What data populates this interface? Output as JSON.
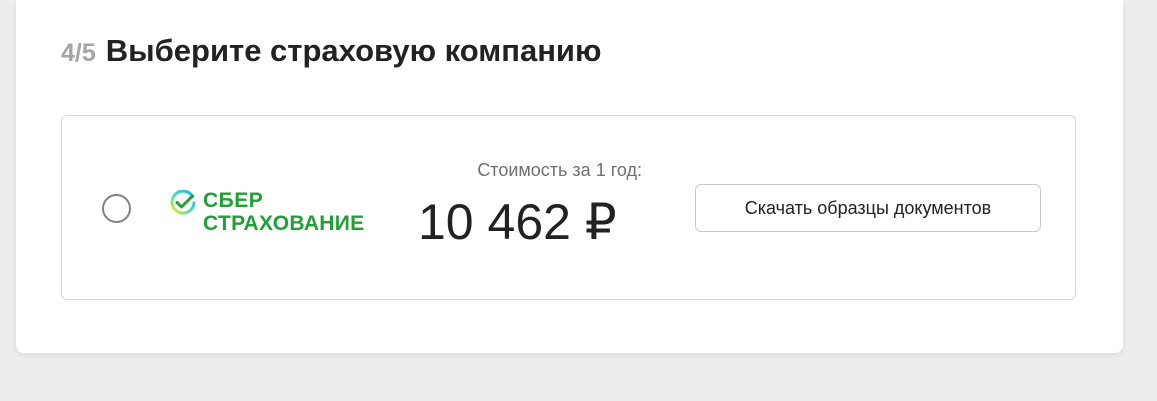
{
  "step": {
    "counter": "4/5",
    "title": "Выберите страховую компанию"
  },
  "offer": {
    "selected": false,
    "insurer": {
      "logo_line1": "СБЕР",
      "logo_line2": "СТРАХОВАНИЕ",
      "logo_icon": "sber-check-circle-icon",
      "brand_color": "#21a038"
    },
    "price_label": "Стоимость за 1 год:",
    "price_value": "10 462 ₽",
    "download_label": "Скачать образцы документов"
  }
}
